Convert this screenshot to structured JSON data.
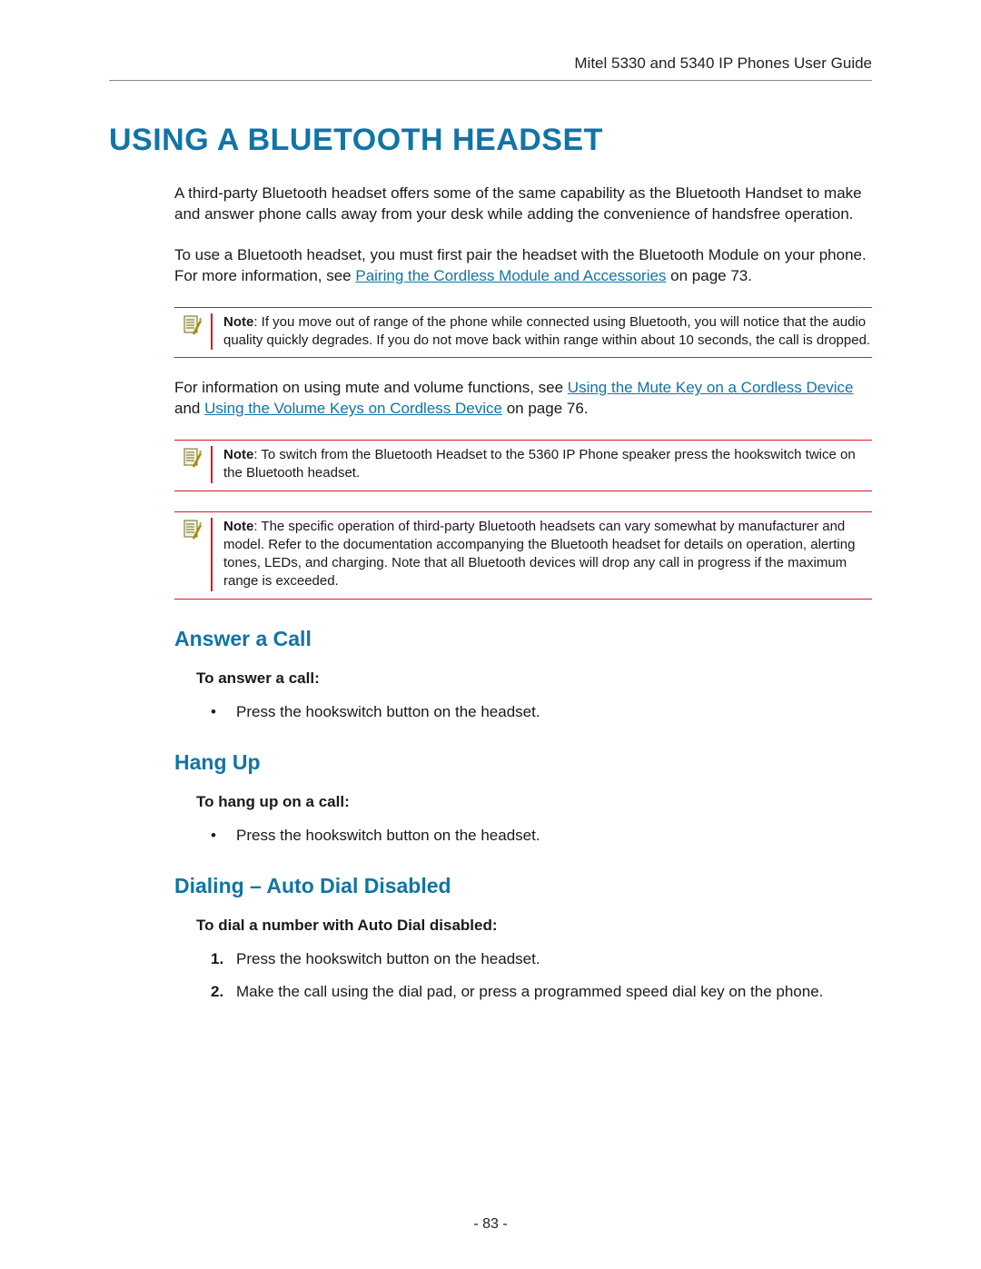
{
  "header": {
    "doc_title": "Mitel 5330 and 5340 IP Phones User Guide"
  },
  "main": {
    "h1": "USING A BLUETOOTH HEADSET",
    "intro_p1": "A third-party Bluetooth headset offers some of the same capability as the Bluetooth Handset to make and answer phone calls away from your desk while adding the convenience of handsfree operation.",
    "intro_p2_pre": "To use a Bluetooth headset, you must first pair the headset with the Bluetooth Module on your phone. For more information, see ",
    "intro_p2_link": "Pairing the Cordless Module and Accessories",
    "intro_p2_post": " on page 73.",
    "note1_label": "Note",
    "note1_body": ": If you move out of range of the phone while connected using Bluetooth, you will notice that the audio quality quickly degrades. If you do not move back within range within about 10 seconds, the call is dropped.",
    "mute_p_pre": "For information on using mute and volume functions, see ",
    "mute_link1": "Using the Mute Key on a Cordless Device",
    "mute_p_mid": " and ",
    "mute_link2": "Using the Volume Keys on Cordless Device",
    "mute_p_post": " on page 76.",
    "note2_label": "Note",
    "note2_body": ": To switch from the Bluetooth Headset to the 5360 IP Phone speaker press the hookswitch twice on the Bluetooth headset.",
    "note3_label": "Note",
    "note3_body": ": The specific operation of third-party Bluetooth headsets can vary somewhat by manufacturer and model. Refer to the documentation accompanying the Bluetooth headset for details on operation, alerting tones, LEDs, and charging. Note that all Bluetooth devices will drop any call in progress if the maximum range is exceeded.",
    "section_answer": {
      "heading": "Answer a Call",
      "subhead": "To answer a call:",
      "bullet1": "Press the hookswitch button on the headset."
    },
    "section_hangup": {
      "heading": "Hang Up",
      "subhead": "To hang up on a call:",
      "bullet1": "Press the hookswitch button on the headset."
    },
    "section_dial": {
      "heading": "Dialing – Auto Dial Disabled",
      "subhead": "To dial a number with Auto Dial disabled:",
      "step1": "Press the hookswitch button on the headset.",
      "step2": "Make the call using the dial pad, or press a programmed speed dial key on the phone."
    }
  },
  "footer": {
    "page_number": "- 83 -"
  }
}
